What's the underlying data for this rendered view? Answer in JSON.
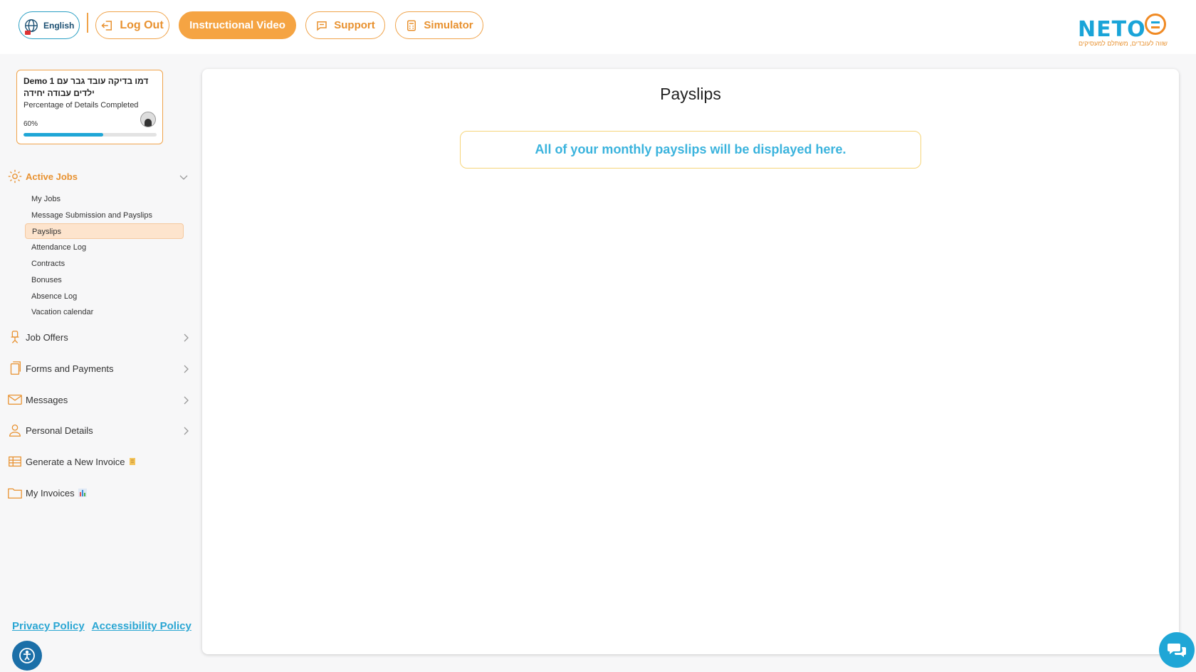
{
  "header": {
    "language_label": "English",
    "logout_label": "Log Out",
    "video_label": "Instructional Video",
    "support_label": "Support",
    "simulator_label": "Simulator",
    "logo_word": "NETO",
    "logo_tagline": "שווה לעובדים, משתלם למעסיקים"
  },
  "profile": {
    "name": "Demo 1 דמו בדיקה עובד גבר עם ילדים עבודה יחידה",
    "completion_label": "Percentage of Details Completed",
    "completion_text": "60%",
    "completion_value": 0.6
  },
  "sidebar": {
    "active_jobs": {
      "label": "Active Jobs",
      "items": [
        {
          "label": "My Jobs"
        },
        {
          "label": "Message Submission and Payslips"
        },
        {
          "label": "Payslips"
        },
        {
          "label": "Attendance Log"
        },
        {
          "label": "Contracts"
        },
        {
          "label": "Bonuses"
        },
        {
          "label": "Absence Log"
        },
        {
          "label": "Vacation calendar"
        }
      ]
    },
    "job_offers": "Job Offers",
    "forms_payments": "Forms and Payments",
    "messages": "Messages",
    "personal_details": "Personal Details",
    "generate_invoice": "Generate a New Invoice",
    "my_invoices": "My Invoices"
  },
  "footer": {
    "privacy": "Privacy Policy",
    "accessibility": "Accessibility Policy"
  },
  "main": {
    "title": "Payslips",
    "notice": "All of your monthly payslips will be displayed here."
  },
  "colors": {
    "accent_orange": "#f5a443",
    "accent_blue": "#1fa6d6"
  }
}
